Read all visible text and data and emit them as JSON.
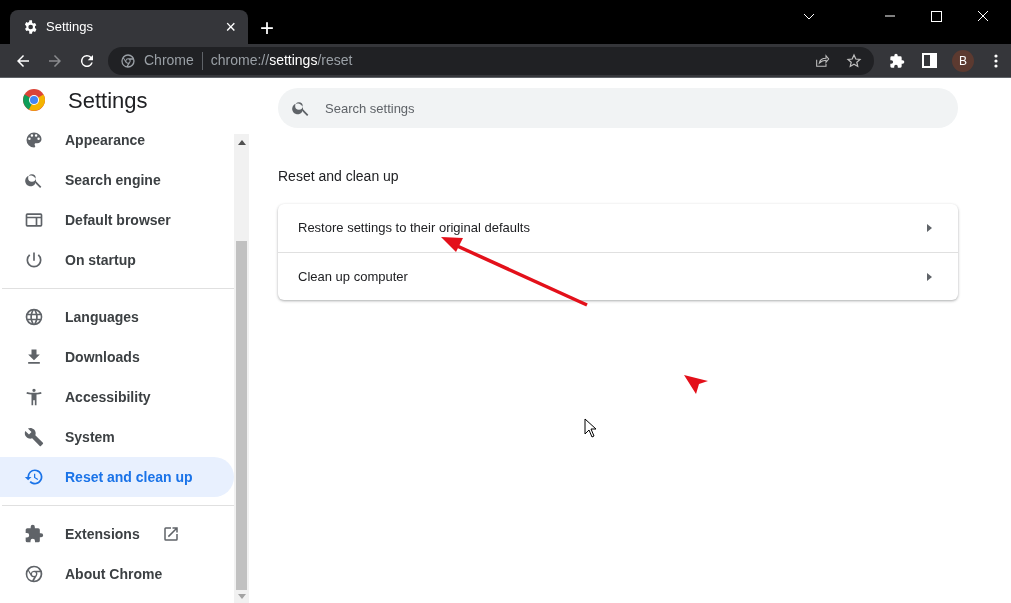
{
  "browser": {
    "tab": {
      "title": "Settings",
      "close": "×"
    },
    "new_tab": "+",
    "address": {
      "site": "Chrome",
      "url_prefix": "chrome://",
      "url_host": "settings",
      "url_path": "/reset"
    },
    "profile": "B"
  },
  "sidebar": {
    "title": "Settings",
    "groups": [
      {
        "items": [
          {
            "label": "Appearance",
            "selected": false
          },
          {
            "label": "Search engine",
            "selected": false
          },
          {
            "label": "Default browser",
            "selected": false
          },
          {
            "label": "On startup",
            "selected": false
          }
        ]
      },
      {
        "items": [
          {
            "label": "Languages",
            "selected": false
          },
          {
            "label": "Downloads",
            "selected": false
          },
          {
            "label": "Accessibility",
            "selected": false
          },
          {
            "label": "System",
            "selected": false
          },
          {
            "label": "Reset and clean up",
            "selected": true
          }
        ]
      },
      {
        "items": [
          {
            "label": "Extensions",
            "selected": false,
            "external": true
          },
          {
            "label": "About Chrome",
            "selected": false,
            "external": false
          }
        ]
      }
    ]
  },
  "search": {
    "placeholder": "Search settings"
  },
  "section": {
    "title": "Reset and clean up",
    "rows": [
      "Restore settings to their original defaults",
      "Clean up computer"
    ]
  }
}
